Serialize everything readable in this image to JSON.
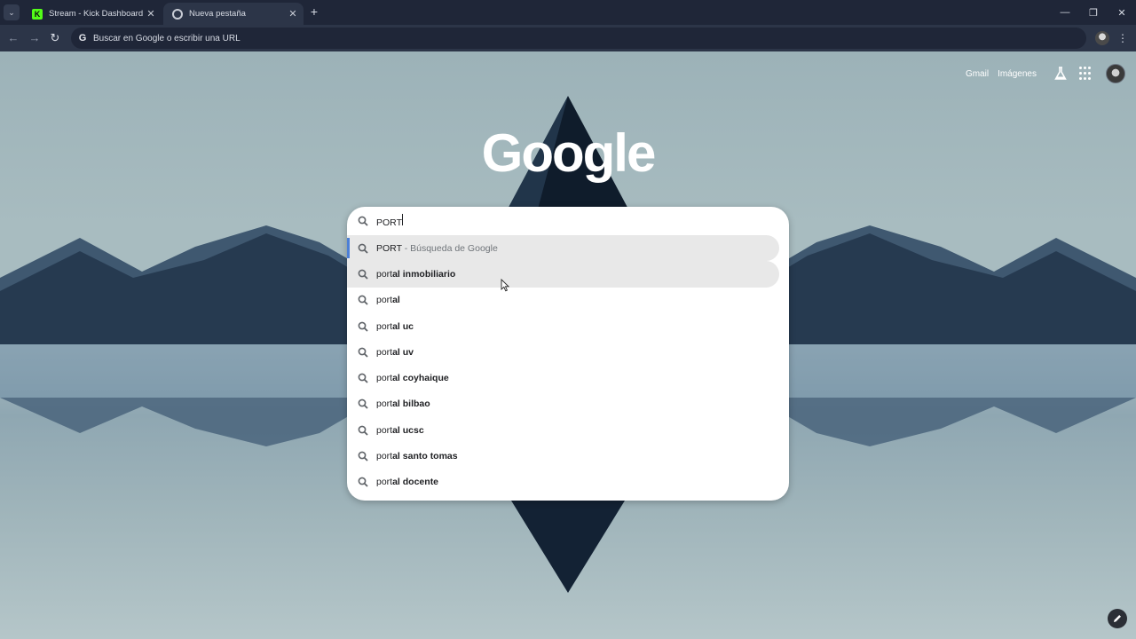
{
  "tabs": [
    {
      "title": "Stream - Kick Dashboard",
      "favicon": "kick-icon"
    },
    {
      "title": "Nueva pestaña",
      "favicon": "chrome-icon"
    }
  ],
  "window_controls": {
    "minimize": "—",
    "restore": "❐",
    "close": "✕"
  },
  "toolbar": {
    "omnibox_placeholder": "Buscar en Google o escribir una URL",
    "omnibox_g": "G"
  },
  "header_links": {
    "gmail": "Gmail",
    "images": "Imágenes"
  },
  "logo": "Google",
  "search": {
    "query": "PORT",
    "suggestions": [
      {
        "typed": "PORT",
        "rest": "",
        "suffix": " - Búsqueda de Google"
      },
      {
        "typed": "port",
        "rest": "al inmobiliario",
        "suffix": ""
      },
      {
        "typed": "port",
        "rest": "al",
        "suffix": ""
      },
      {
        "typed": "port",
        "rest": "al uc",
        "suffix": ""
      },
      {
        "typed": "port",
        "rest": "al uv",
        "suffix": ""
      },
      {
        "typed": "port",
        "rest": "al coyhaique",
        "suffix": ""
      },
      {
        "typed": "port",
        "rest": "al bilbao",
        "suffix": ""
      },
      {
        "typed": "port",
        "rest": "al ucsc",
        "suffix": ""
      },
      {
        "typed": "port",
        "rest": "al santo tomas",
        "suffix": ""
      },
      {
        "typed": "port",
        "rest": "al docente",
        "suffix": ""
      }
    ]
  },
  "colors": {
    "accent": "#4c7fd6",
    "kick": "#53fc18",
    "tab_bar": "#1f2638",
    "toolbar": "#2c3548"
  }
}
